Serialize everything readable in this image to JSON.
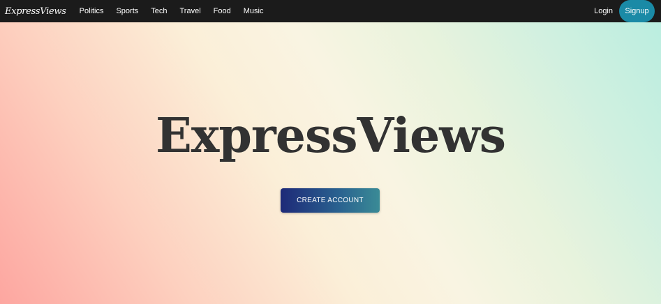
{
  "navbar": {
    "brand": "ExpressViews",
    "links": [
      "Politics",
      "Sports",
      "Tech",
      "Travel",
      "Food",
      "Music"
    ],
    "login_label": "Login",
    "signup_label": "Signup"
  },
  "hero": {
    "title": "ExpressViews",
    "cta_label": "CREATE ACCOUNT"
  },
  "colors": {
    "navbar_bg": "#1b1b1b",
    "signup_bg": "#1a8aa6",
    "cta_gradient_start": "#1e2a78",
    "cta_gradient_end": "#3a8b96",
    "title_text": "#323232"
  }
}
